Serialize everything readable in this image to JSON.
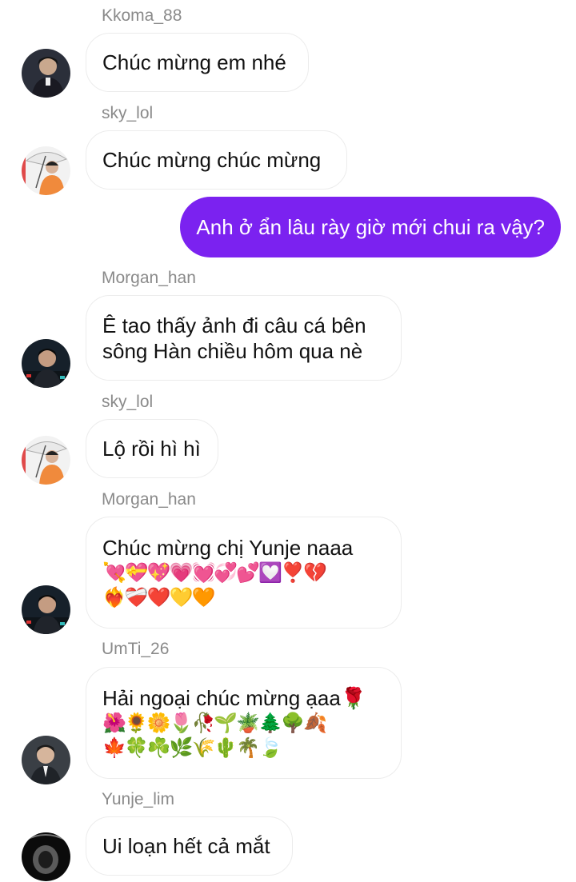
{
  "colors": {
    "outgoing_bubble": "#7b22f0",
    "incoming_border": "#ececec",
    "username": "#8a8a8a"
  },
  "messages": [
    {
      "sender": "Kkoma_88",
      "lines": [
        "Chúc mừng em nhé"
      ]
    },
    {
      "sender": "sky_lol",
      "lines": [
        "Chúc mừng chúc mừng"
      ]
    },
    {
      "outgoing": true,
      "text": "Anh ở ẩn lâu rày giờ mới chui ra vậy?"
    },
    {
      "sender": "Morgan_han",
      "lines": [
        "Ê tao thấy ảnh đi câu cá bên",
        "sông Hàn chiều hôm qua nè"
      ]
    },
    {
      "sender": "sky_lol",
      "lines": [
        "Lộ rồi hì hì"
      ]
    },
    {
      "sender": "Morgan_han",
      "lines": [
        " Chúc mừng chị Yunje naaa",
        "💘💝💖💗💓💞💕💟❣️💔",
        "❤️‍🔥❤️‍🩹❤️💛🧡"
      ]
    },
    {
      "sender": "UmTi_26",
      "lines": [
        "Hải ngoại chúc mừng ạaa🌹",
        "🌺🌻🌼🌷🥀🌱🪴🌲🌳🍂",
        "🍁🍀☘️🌿🌾🌵🌴🍃"
      ]
    },
    {
      "sender": "Yunje_lim",
      "lines": [
        "Ui loạn hết cả mắt"
      ]
    }
  ]
}
